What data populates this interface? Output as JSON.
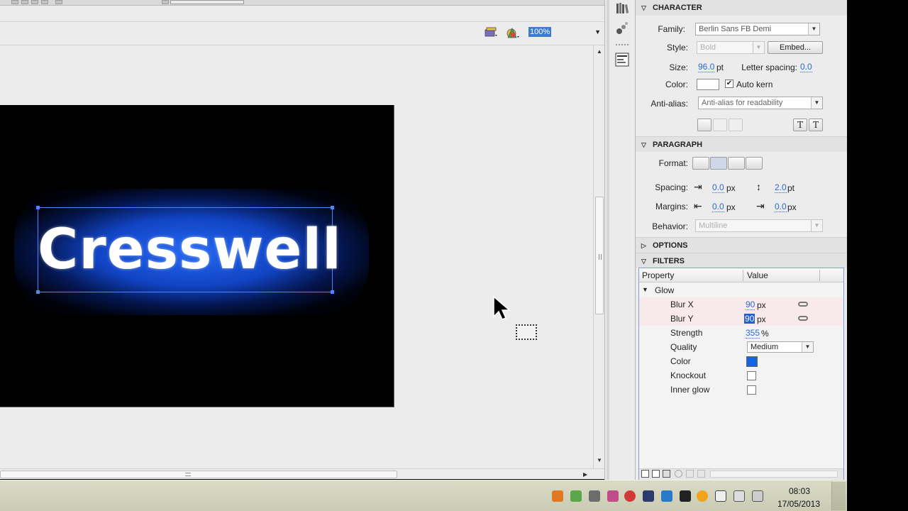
{
  "toolbar": {
    "zoom_value": "100%"
  },
  "stage": {
    "text": "Cresswell",
    "glow_color": "#1a5cff"
  },
  "character": {
    "header": "CHARACTER",
    "family_label": "Family:",
    "family_value": "Berlin Sans FB Demi",
    "style_label": "Style:",
    "style_value": "Bold",
    "embed_button": "Embed...",
    "size_label": "Size:",
    "size_value": "96.0",
    "size_unit": "pt",
    "letter_spacing_label": "Letter spacing:",
    "letter_spacing_value": "0.0",
    "color_label": "Color:",
    "text_color": "#ffffff",
    "auto_kern_label": "Auto kern",
    "auto_kern_checked": true,
    "anti_alias_label": "Anti-alias:",
    "anti_alias_value": "Anti-alias for readability"
  },
  "paragraph": {
    "header": "PARAGRAPH",
    "format_label": "Format:",
    "spacing_label": "Spacing:",
    "spacing_indent_value": "0.0",
    "spacing_indent_unit": "px",
    "spacing_line_value": "2.0",
    "spacing_line_unit": "pt",
    "margins_label": "Margins:",
    "margin_left_value": "0.0",
    "margin_left_unit": "px",
    "margin_right_value": "0.0",
    "margin_right_unit": "px",
    "behavior_label": "Behavior:",
    "behavior_value": "Multiline"
  },
  "options": {
    "header": "OPTIONS"
  },
  "filters": {
    "header": "FILTERS",
    "col_property": "Property",
    "col_value": "Value",
    "group": "Glow",
    "rows": [
      {
        "name": "Blur X",
        "value": "90",
        "unit": "px"
      },
      {
        "name": "Blur Y",
        "value": "90",
        "unit": "px"
      },
      {
        "name": "Strength",
        "value": "355",
        "unit": "%"
      },
      {
        "name": "Quality",
        "value": "Medium"
      },
      {
        "name": "Color",
        "value": "#1463e0"
      },
      {
        "name": "Knockout",
        "checked": false
      },
      {
        "name": "Inner glow",
        "checked": false
      }
    ]
  },
  "taskbar": {
    "time": "08:03",
    "date": "17/05/2013"
  }
}
